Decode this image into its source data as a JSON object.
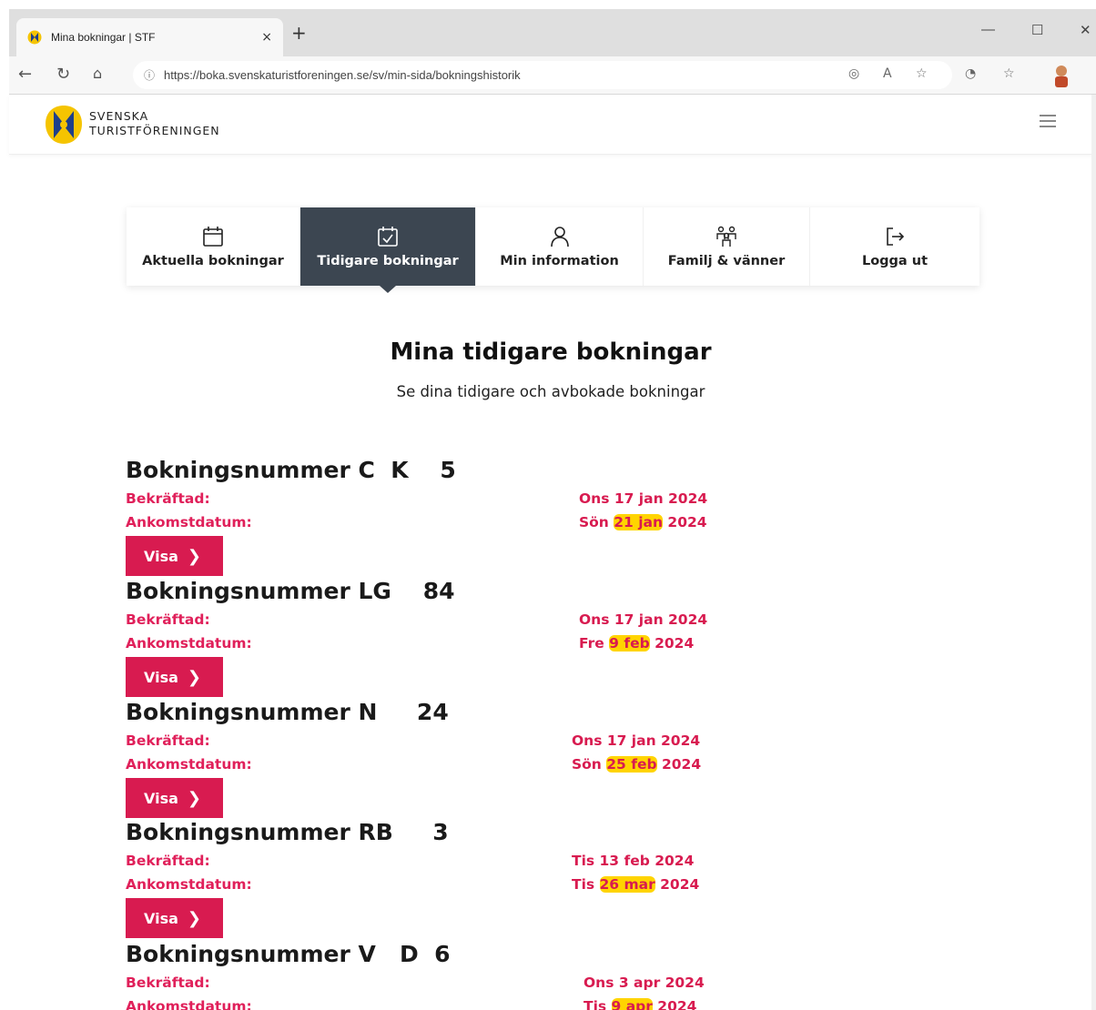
{
  "browser": {
    "tab_title": "Mina bokningar | STF",
    "tab_close": "×",
    "new_tab": "+",
    "url": "https://boka.svenskaturistforeningen.se/sv/min-sida/bokningshistorik",
    "win_min": "—",
    "win_max": "☐",
    "win_close": "✕"
  },
  "header": {
    "brand_line1": "SVENSKA",
    "brand_line2": "TURISTFÖRENINGEN"
  },
  "nav": {
    "items": [
      {
        "label": "Aktuella bokningar",
        "icon": "calendar-icon"
      },
      {
        "label": "Tidigare bokningar",
        "icon": "calendar-check-icon",
        "active": true
      },
      {
        "label": "Min information",
        "icon": "user-icon"
      },
      {
        "label": "Familj & vänner",
        "icon": "family-icon"
      },
      {
        "label": "Logga ut",
        "icon": "logout-icon"
      }
    ]
  },
  "page": {
    "title": "Mina tidigare bokningar",
    "subtitle": "Se dina tidigare och avbokade bokningar"
  },
  "bookings": [
    {
      "number": "Bokningsnummer C  K    5",
      "confirmed_label": "Bekräftad:",
      "arrival_label": "Ankomstdatum:",
      "confirmed": "Ons 17 jan 2024",
      "arrival_pre": "Sön ",
      "arrival_hl": "21 jan",
      "arrival_post": " 2024",
      "button": "Visa"
    },
    {
      "number": "Bokningsnummer LG    84",
      "confirmed_label": "Bekräftad:",
      "arrival_label": "Ankomstdatum:",
      "confirmed": "Ons 17 jan 2024",
      "arrival_pre": "Fre ",
      "arrival_hl": "9 feb",
      "arrival_post": " 2024",
      "button": "Visa"
    },
    {
      "number": "Bokningsnummer N     24",
      "confirmed_label": "Bekräftad:",
      "arrival_label": "Ankomstdatum:",
      "confirmed": "Ons 17 jan 2024",
      "arrival_pre": "Sön ",
      "arrival_hl": "25 feb",
      "arrival_post": " 2024",
      "button": "Visa"
    },
    {
      "number": "Bokningsnummer RB     3",
      "confirmed_label": "Bekräftad:",
      "arrival_label": "Ankomstdatum:",
      "confirmed": "Tis 13 feb 2024",
      "arrival_pre": "Tis ",
      "arrival_hl": "26 mar",
      "arrival_post": " 2024",
      "button": "Visa"
    },
    {
      "number": "Bokningsnummer V   D  6",
      "confirmed_label": "Bekräftad:",
      "arrival_label": "Ankomstdatum:",
      "confirmed": "Ons 3 apr 2024",
      "arrival_pre": "Tis ",
      "arrival_hl": "9 apr",
      "arrival_post": " 2024",
      "button": "Visa"
    }
  ],
  "colors": {
    "accent": "#d81b50",
    "nav_active": "#3c4651",
    "highlight": "#ffd400"
  }
}
